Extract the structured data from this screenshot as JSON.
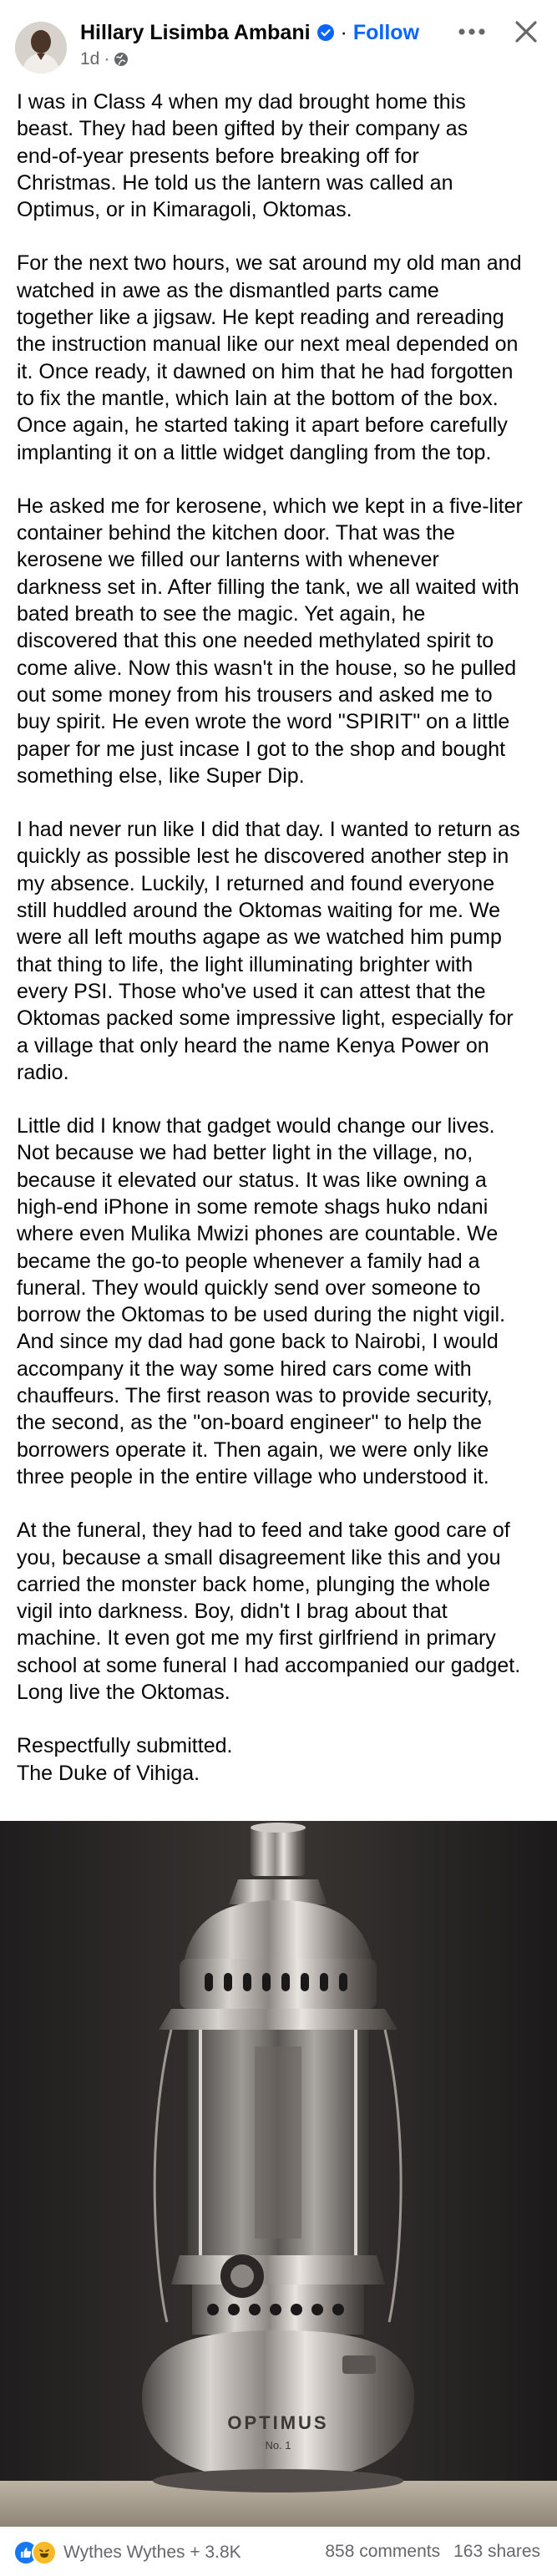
{
  "header": {
    "author": "Hillary Lisimba Ambani",
    "separator": "·",
    "follow_label": "Follow",
    "timestamp": "1d",
    "meta_separator": "·",
    "verified_icon": "verified-badge-icon",
    "privacy_icon": "globe-icon",
    "more_icon": "more-options-icon",
    "close_icon": "close-icon",
    "accent_color": "#0866ff"
  },
  "post": {
    "paragraphs": [
      [
        "I was in Class 4 when my dad brought home this",
        "beast. They had been gifted by their company as",
        "end-of-year presents before breaking off for",
        "Christmas. He told us the lantern was called an",
        "Optimus, or in Kimaragoli, Oktomas."
      ],
      [
        "For the next two hours, we sat around my old man and",
        "watched in awe as the dismantled parts came",
        "together like a jigsaw. He kept reading and rereading",
        "the instruction manual like our next meal depended on",
        "it. Once ready, it dawned on him that he had forgotten",
        "to fix the mantle, which lain at the bottom of the box.",
        "Once again, he started taking it apart before carefully",
        "implanting it on a little widget dangling from the top."
      ],
      [
        "He asked me for kerosene, which we kept in a five-liter",
        "container behind the kitchen door. That was the",
        "kerosene we filled our lanterns with whenever",
        "darkness set in. After filling the tank, we all waited with",
        "bated breath to see the magic. Yet again, he",
        "discovered that this one needed methylated spirit to",
        "come alive. Now this wasn't in the house, so he pulled",
        "out some money from his trousers and asked me to",
        "buy spirit. He even wrote the word \"SPIRIT\" on a little",
        "paper for me just incase I got to the shop and bought",
        "something else, like Super Dip."
      ],
      [
        "I had never run like I did that day. I wanted to return as",
        "quickly as possible lest he discovered another step in",
        "my absence. Luckily, I returned and found everyone",
        "still huddled around the Oktomas waiting for me. We",
        "were all left mouths agape as we watched him pump",
        "that thing to life, the light illuminating brighter with",
        "every PSI. Those who've used it can attest that the",
        "Oktomas packed some impressive light, especially for",
        "a village that only heard the name Kenya Power on",
        "radio."
      ],
      [
        "Little did I know that gadget would change our lives.",
        "Not because we had better light in the village, no,",
        "because it elevated our status. It was like owning a",
        "high-end iPhone in some remote shags huko ndani",
        "where even Mulika Mwizi phones are countable. We",
        "became the go-to people whenever a family had a",
        "funeral. They would quickly send over someone to",
        "borrow the Oktomas to be used during the night vigil.",
        "And since my dad had gone back to Nairobi, I would",
        "accompany it the way some hired cars come with",
        "chauffeurs. The first reason was to provide security,",
        "the second, as the \"on-board engineer\" to help the",
        "borrowers operate it. Then again, we were only like",
        "three people in the entire village who understood it."
      ],
      [
        "At the funeral, they had to feed and take good care of",
        "you, because a small disagreement like this and you",
        "carried the monster back home, plunging the whole",
        "vigil into darkness. Boy, didn't I brag about that",
        "machine. It even got me my first girlfriend in primary",
        "school at some funeral I had accompanied our gadget.",
        "Long live the Oktomas."
      ]
    ],
    "signoff": [
      "Respectfully submitted.",
      "The Duke of Vihiga."
    ]
  },
  "photo": {
    "subject": "lantern-image",
    "lettering": [
      "OPTIMUS",
      "No.",
      "1"
    ]
  },
  "footer": {
    "reaction_icons": [
      "like-reaction-icon",
      "haha-reaction-icon"
    ],
    "reactions_text": "Wythes Wythes + 3.8K",
    "comments": "858 comments",
    "shares": "163 shares",
    "like_color": "#1877f2",
    "haha_color": "#f7b928"
  }
}
